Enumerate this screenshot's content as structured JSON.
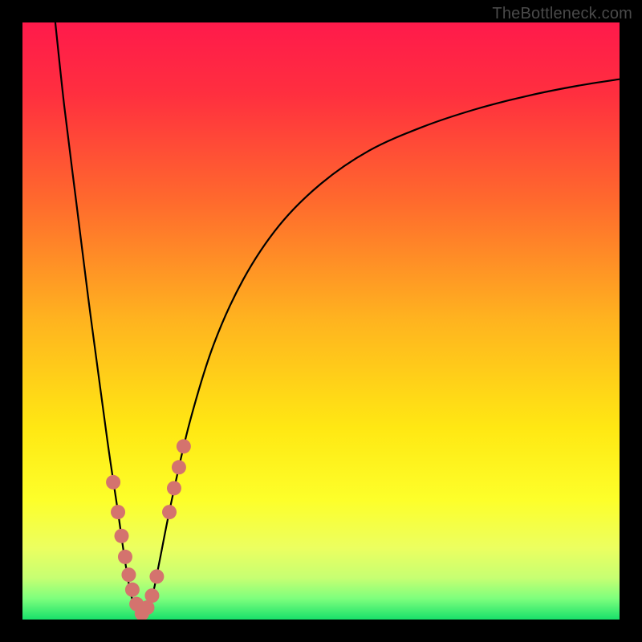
{
  "watermark": "TheBottleneck.com",
  "chart_data": {
    "type": "line",
    "title": "",
    "xlabel": "",
    "ylabel": "",
    "xlim": [
      0,
      100
    ],
    "ylim": [
      0,
      100
    ],
    "background_gradient": {
      "stops": [
        {
          "offset": 0.0,
          "color": "#ff1a4b"
        },
        {
          "offset": 0.12,
          "color": "#ff2f3f"
        },
        {
          "offset": 0.3,
          "color": "#ff6a2d"
        },
        {
          "offset": 0.5,
          "color": "#ffb41f"
        },
        {
          "offset": 0.68,
          "color": "#ffe813"
        },
        {
          "offset": 0.8,
          "color": "#fdff2a"
        },
        {
          "offset": 0.88,
          "color": "#ecff60"
        },
        {
          "offset": 0.93,
          "color": "#c7ff72"
        },
        {
          "offset": 0.965,
          "color": "#7dff7d"
        },
        {
          "offset": 1.0,
          "color": "#18e06a"
        }
      ]
    },
    "series": [
      {
        "name": "bottleneck-curve",
        "x": [
          5.5,
          7,
          9,
          11,
          13,
          14.5,
          16,
          17,
          18,
          19,
          20,
          21,
          22,
          23,
          25,
          28,
          32,
          37,
          43,
          50,
          58,
          67,
          76,
          85,
          93,
          100
        ],
        "y": [
          100,
          86,
          70,
          54,
          39,
          28,
          18,
          11,
          5,
          1.5,
          0,
          1.5,
          5,
          10,
          20,
          33,
          46,
          57,
          66,
          73,
          78.5,
          82.5,
          85.5,
          87.8,
          89.4,
          90.5
        ]
      }
    ],
    "markers": {
      "name": "highlight-dots",
      "color": "#d4736e",
      "radius": 9,
      "points": [
        {
          "x": 15.2,
          "y": 23
        },
        {
          "x": 16.0,
          "y": 18
        },
        {
          "x": 16.6,
          "y": 14
        },
        {
          "x": 17.2,
          "y": 10.5
        },
        {
          "x": 17.8,
          "y": 7.5
        },
        {
          "x": 18.4,
          "y": 5
        },
        {
          "x": 19.1,
          "y": 2.6
        },
        {
          "x": 20.0,
          "y": 1.0
        },
        {
          "x": 20.9,
          "y": 2.0
        },
        {
          "x": 21.7,
          "y": 4.0
        },
        {
          "x": 22.5,
          "y": 7.2
        },
        {
          "x": 24.6,
          "y": 18
        },
        {
          "x": 25.4,
          "y": 22
        },
        {
          "x": 26.2,
          "y": 25.5
        },
        {
          "x": 27.0,
          "y": 29
        }
      ]
    }
  }
}
